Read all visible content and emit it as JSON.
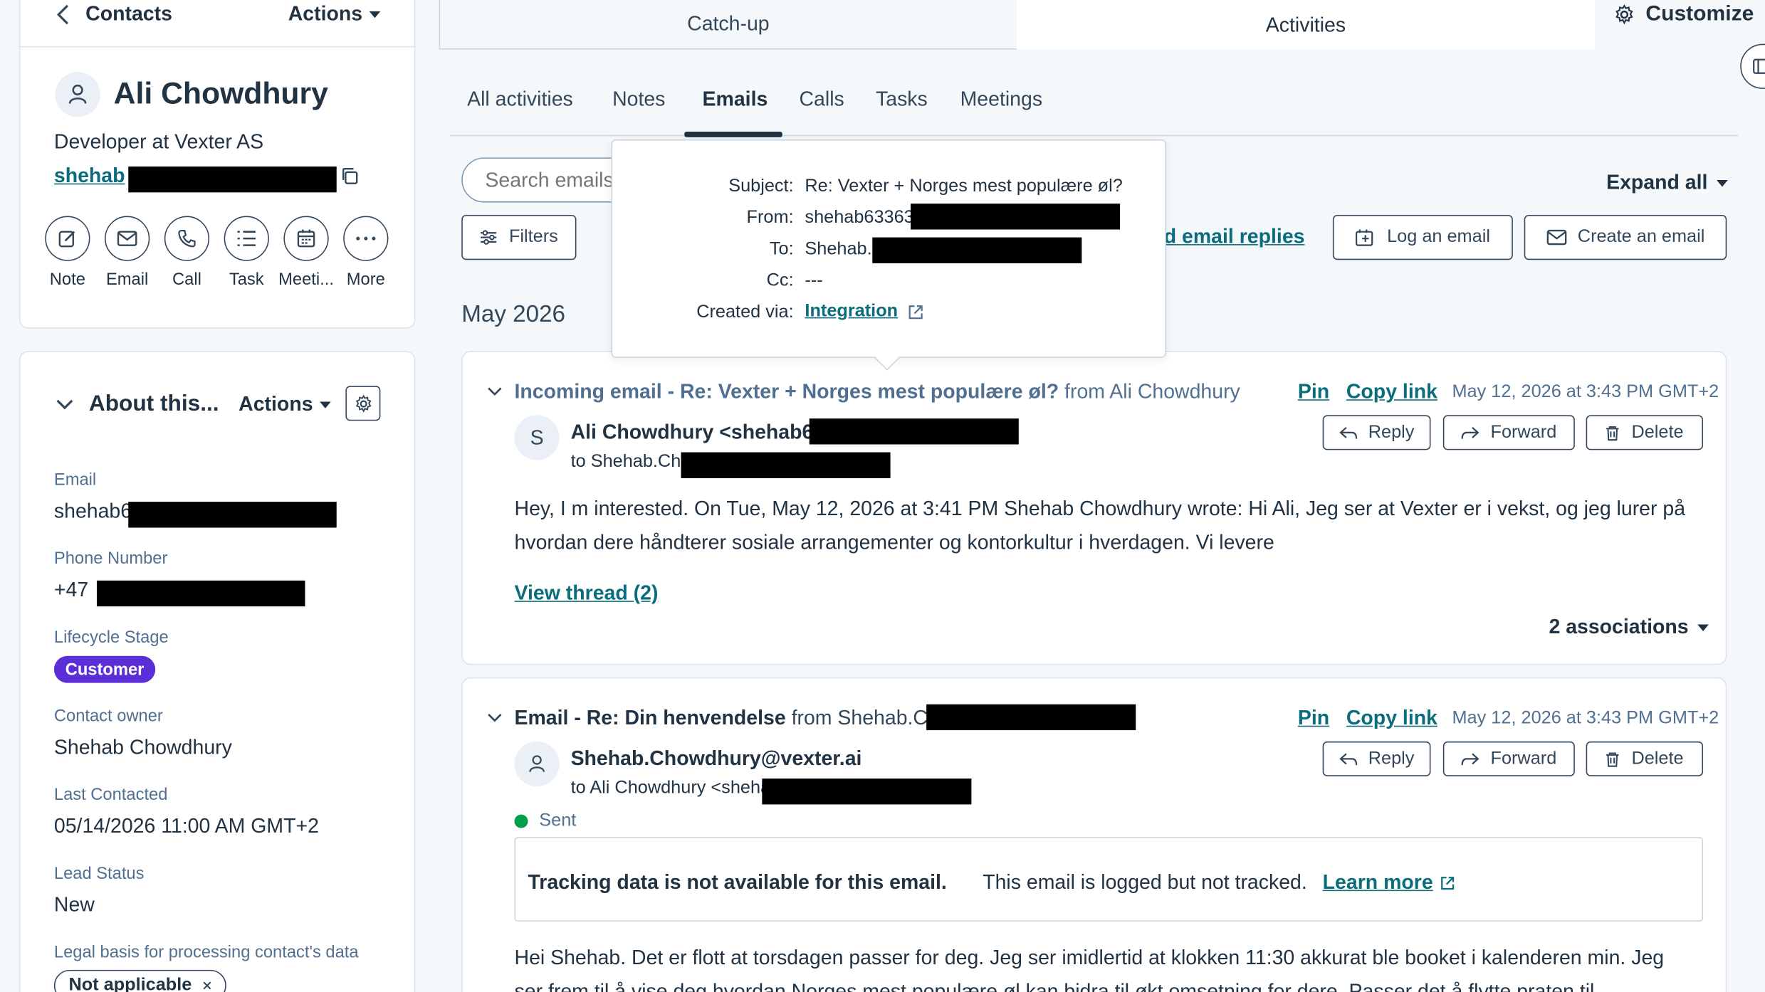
{
  "left": {
    "back_label": "Contacts",
    "actions_label": "Actions",
    "contact_name": "Ali Chowdhury",
    "job_title": "Developer at Vexter AS",
    "email_partial": "shehab",
    "quick_actions": [
      {
        "label": "Note",
        "icon": "note-icon"
      },
      {
        "label": "Email",
        "icon": "email-icon"
      },
      {
        "label": "Call",
        "icon": "phone-icon"
      },
      {
        "label": "Task",
        "icon": "task-icon"
      },
      {
        "label": "Meeti...",
        "icon": "calendar-icon"
      },
      {
        "label": "More",
        "icon": "more-icon"
      }
    ],
    "about": {
      "title": "About this...",
      "actions_label": "Actions",
      "props": {
        "email_label": "Email",
        "email_value": "shehab6",
        "phone_label": "Phone Number",
        "phone_value": "+47",
        "lifecycle_label": "Lifecycle Stage",
        "lifecycle_value": "Customer",
        "owner_label": "Contact owner",
        "owner_value": "Shehab Chowdhury",
        "last_contacted_label": "Last Contacted",
        "last_contacted_value": "05/14/2026 11:00 AM GMT+2",
        "lead_status_label": "Lead Status",
        "lead_status_value": "New",
        "legal_label": "Legal basis for processing contact's data",
        "legal_value": "Not applicable"
      }
    }
  },
  "main": {
    "top_tabs": [
      "Catch-up",
      "Activities"
    ],
    "customize_label": "Customize",
    "sub_tabs": [
      "All activities",
      "Notes",
      "Emails",
      "Calls",
      "Tasks",
      "Meetings"
    ],
    "active_sub_tab": "Emails",
    "search_placeholder": "Search emails",
    "filters_label": "Filters",
    "expand_all_label": "Expand all",
    "email_replies_label": "d email replies",
    "log_email_label": "Log an email",
    "create_email_label": "Create an email",
    "month_label": "May 2026",
    "tooltip": {
      "subject_label": "Subject:",
      "subject_value": "Re: Vexter + Norges mest populære øl?",
      "from_label": "From:",
      "from_value": "shehab63363",
      "to_label": "To:",
      "to_value": "Shehab.C",
      "cc_label": "Cc:",
      "cc_value": "---",
      "created_label": "Created via:",
      "created_value": "Integration"
    },
    "email1": {
      "title_bold": "Incoming email - Re: Vexter + Norges mest populære øl?",
      "title_from": "from Ali Chowdhury",
      "pin": "Pin",
      "copy_link": "Copy link",
      "date": "May 12, 2026 at 3:43 PM GMT+2",
      "avatar_letter": "S",
      "sender": "Ali Chowdhury <shehab6",
      "to": "to Shehab.Ch",
      "reply": "Reply",
      "forward": "Forward",
      "delete": "Delete",
      "body_line1": "Hey, I m interested. On Tue, May 12, 2026 at 3:41 PM Shehab Chowdhury wrote: Hi Ali, Jeg ser at Vexter er i vekst, og jeg lurer på",
      "body_line2": "hvordan dere håndterer sosiale arrangementer og kontorkultur i hverdagen. Vi levere",
      "view_thread": "View thread (2)",
      "associations": "2 associations"
    },
    "email2": {
      "title_bold": "Email - Re: Din henvendelse",
      "title_from": "from Shehab.C",
      "pin": "Pin",
      "copy_link": "Copy link",
      "date": "May 12, 2026 at 3:43 PM GMT+2",
      "sender": "Shehab.Chowdhury@vexter.ai",
      "to": "to Ali Chowdhury <sheha",
      "reply": "Reply",
      "forward": "Forward",
      "delete": "Delete",
      "status": "Sent",
      "tracking_bold": "Tracking data is not available for this email.",
      "tracking_text": "This email is logged but not tracked.",
      "learn_more": "Learn more",
      "body_line1": "Hei Shehab. Det er flott at torsdagen passer for deg. Jeg ser imidlertid at klokken 11:30 akkurat ble booket i kalenderen min. Jeg",
      "body_line2": "ser frem til å vise deg hvordan Norges mest populære øl kan bidra til økt omsetning for dere. Passer det å flytte praten til"
    }
  },
  "colors": {
    "accent": "#0b6c7c",
    "customer_badge": "#5c2ed8",
    "sent_dot": "#00a04a",
    "tab_underline": "#213343"
  }
}
